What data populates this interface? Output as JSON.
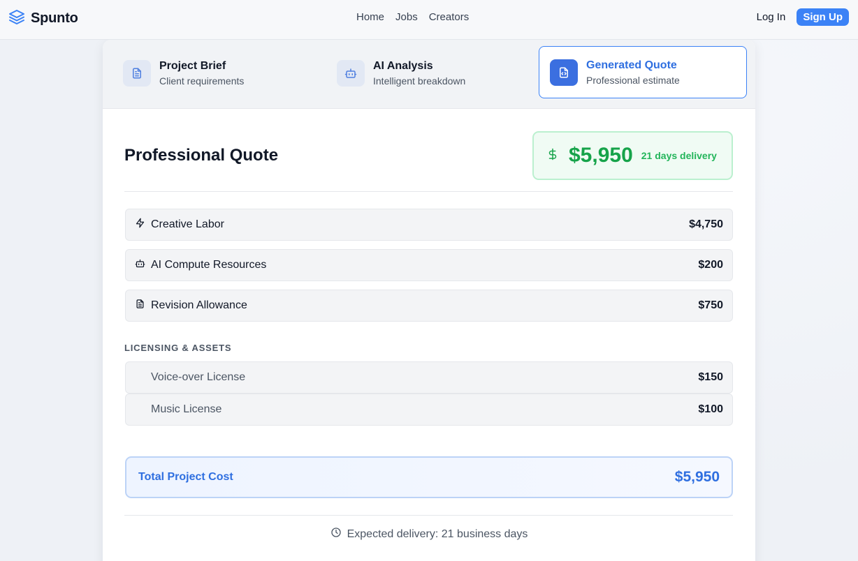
{
  "header": {
    "brand": "Spunto",
    "nav": [
      "Home",
      "Jobs",
      "Creators"
    ],
    "login_label": "Log In",
    "signup_label": "Sign Up"
  },
  "steps": [
    {
      "title": "Project Brief",
      "subtitle": "Client requirements",
      "icon": "document-icon"
    },
    {
      "title": "AI Analysis",
      "subtitle": "Intelligent breakdown",
      "icon": "robot-icon"
    },
    {
      "title": "Generated Quote",
      "subtitle": "Professional estimate",
      "icon": "code-file-icon",
      "active": true
    }
  ],
  "quote": {
    "title": "Professional Quote",
    "amount": "$5,950",
    "delivery": "21 days delivery"
  },
  "line_items": [
    {
      "label": "Creative Labor",
      "amount": "$4,750",
      "icon": "lightning-icon"
    },
    {
      "label": "AI Compute Resources",
      "amount": "$200",
      "icon": "robot-icon"
    },
    {
      "label": "Revision Allowance",
      "amount": "$750",
      "icon": "document-icon"
    }
  ],
  "licensing": {
    "section_label": "LICENSING & ASSETS",
    "items": [
      {
        "label": "Voice-over License",
        "amount": "$150"
      },
      {
        "label": "Music License",
        "amount": "$100"
      }
    ]
  },
  "total": {
    "label": "Total Project Cost",
    "amount": "$5,950"
  },
  "footer": {
    "note": "Expected delivery: 21 business days"
  },
  "colors": {
    "accent": "#3b82f6",
    "success": "#16a34a"
  }
}
